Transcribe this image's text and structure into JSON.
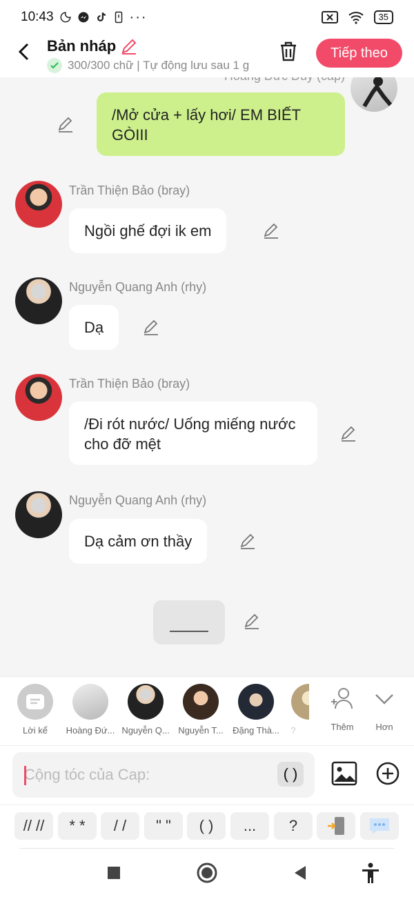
{
  "status_bar": {
    "time": "10:43",
    "battery": "35"
  },
  "header": {
    "title": "Bản nháp",
    "subtitle": "300/300 chữ | Tự động lưu sau 1 g",
    "next_button": "Tiếp theo"
  },
  "chat": {
    "top_partial_name": "Hoàng Đức Duy (cap)",
    "messages": [
      {
        "sender": "",
        "text": "/Mở cửa + lấy hơi/ EM BIẾT GÒIII",
        "mine": true
      },
      {
        "sender": "Trần Thiện Bảo (bray)",
        "text": "Ngồi ghế đợi ik em"
      },
      {
        "sender": "Nguyễn Quang Anh (rhy)",
        "text": "Dạ"
      },
      {
        "sender": "Trần Thiện Bảo (bray)",
        "text": "/Đi rót nước/ Uống miếng nước cho đỡ mệt"
      },
      {
        "sender": "Nguyễn Quang Anh (rhy)",
        "text": "Dạ cảm ơn thầy"
      }
    ]
  },
  "characters": [
    {
      "label": "Lời kể"
    },
    {
      "label": "Hoàng Đứ..."
    },
    {
      "label": "Nguyễn Q..."
    },
    {
      "label": "Nguyễn T..."
    },
    {
      "label": "Đặng Thà..."
    },
    {
      "label": "?"
    }
  ],
  "char_actions": {
    "more": "Thêm",
    "collapse": "Hơn"
  },
  "input": {
    "placeholder": "Cộng tóc của Cap:",
    "paren": "( )"
  },
  "symbols": [
    "// //",
    "* *",
    "/ /",
    "\" \"",
    "( )",
    "...",
    "?"
  ],
  "colors": {
    "accent": "#f24b6a",
    "mine_bubble": "#cdf08c",
    "background": "#f5f5f5"
  }
}
